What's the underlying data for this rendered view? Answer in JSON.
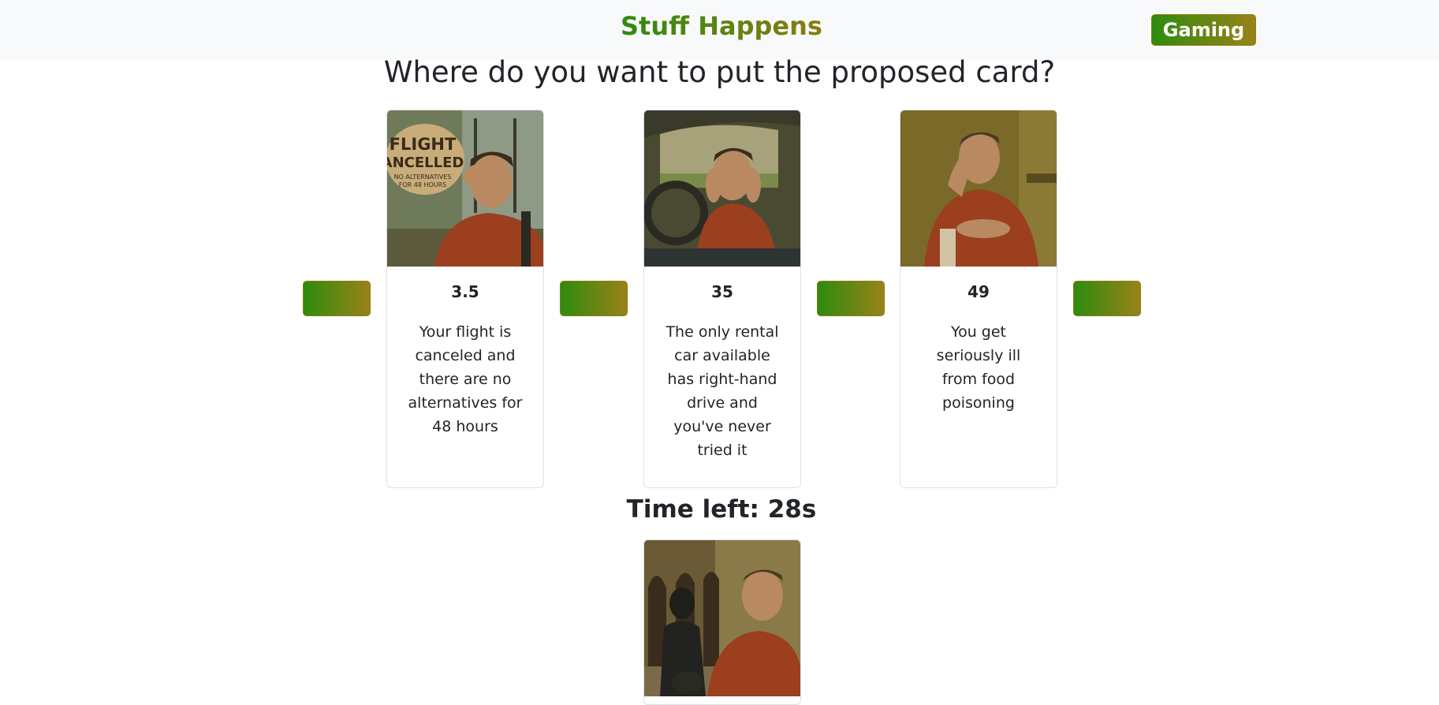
{
  "navbar": {
    "brand_title": "Stuff Happens",
    "mode_badge": "Gaming"
  },
  "question": "Where do you want to put the proposed card?",
  "cards": [
    {
      "value": "3.5",
      "description": "Your flight is canceled and there are no alternatives for 48 hours",
      "image": "man-holding-head-flight-cancelled-sign"
    },
    {
      "value": "35",
      "description": "The only rental car available has right-hand drive and you've never tried it",
      "image": "man-in-car-hands-on-face"
    },
    {
      "value": "49",
      "description": "You get seriously ill from food poisoning",
      "image": "man-holding-stomach-in-pain"
    }
  ],
  "timer": "Time left: 28s",
  "proposed_card": {
    "image": "man-being-robbed-by-thief"
  },
  "colors": {
    "gradient_start": "#2e8b0e",
    "gradient_end": "#9a8218",
    "navbar_bg": "#f8f9fa",
    "card_border": "#dee2e6"
  }
}
